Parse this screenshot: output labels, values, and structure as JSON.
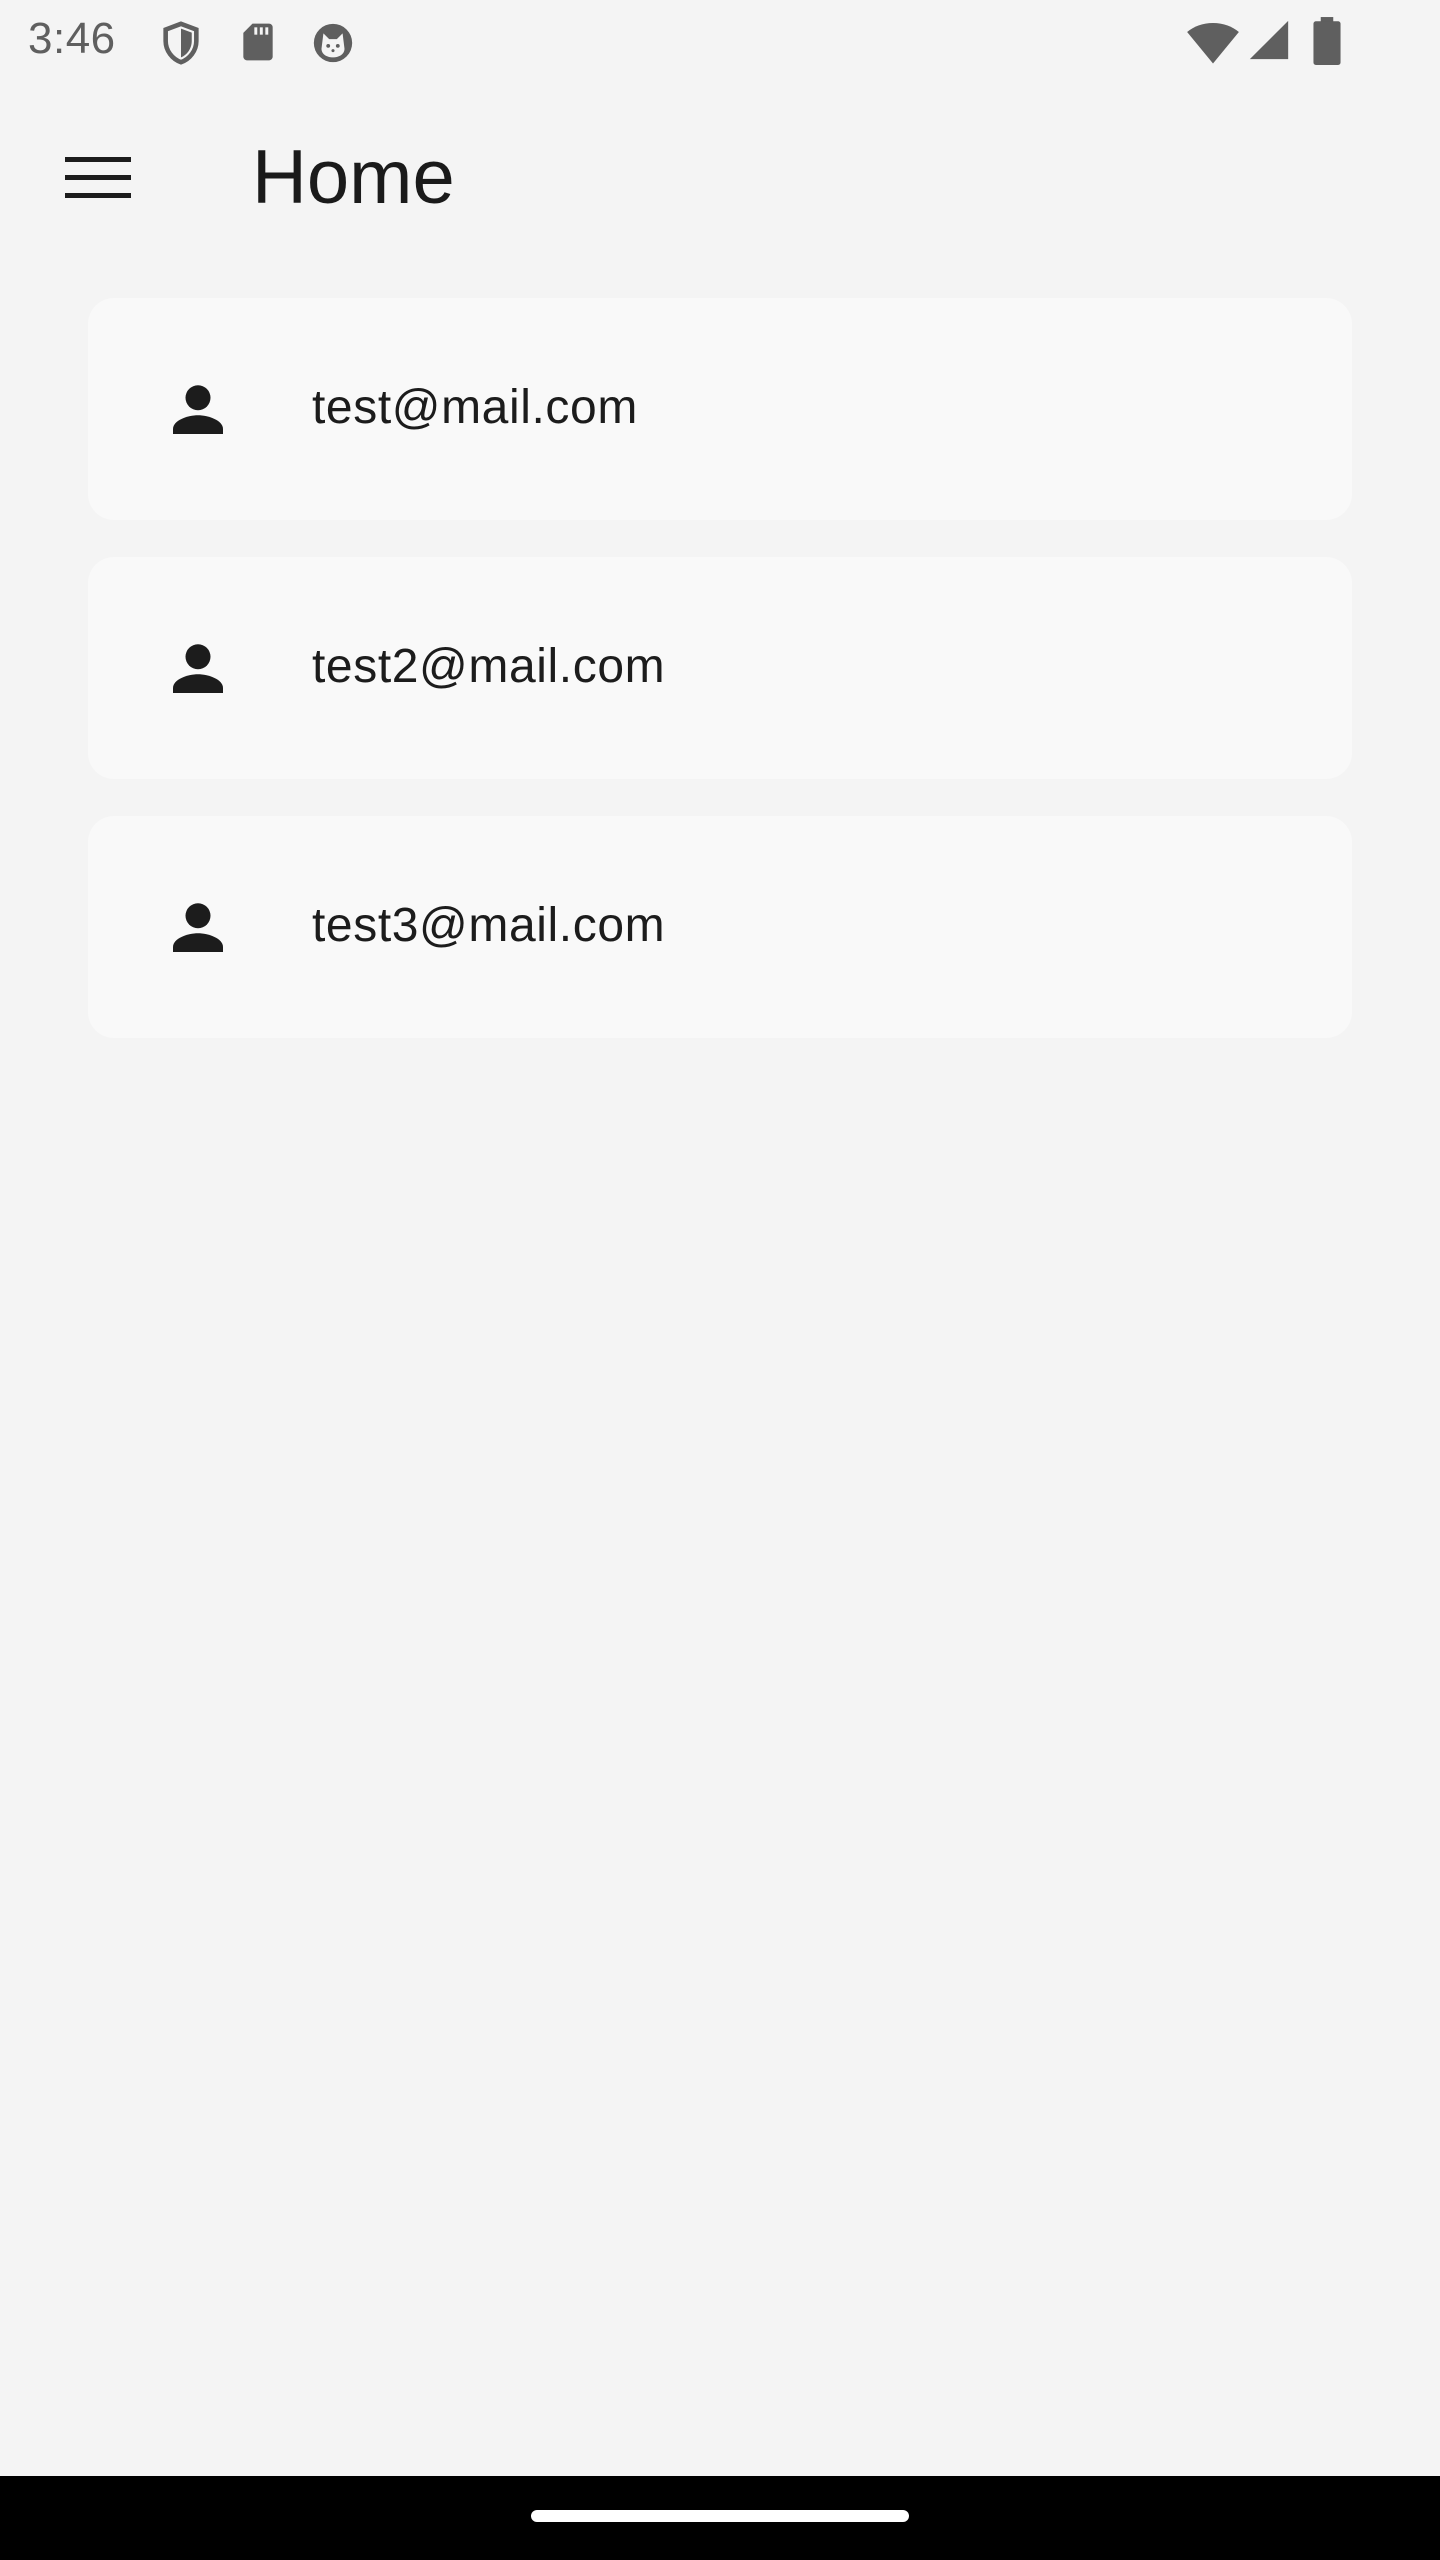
{
  "status_bar": {
    "time": "3:46",
    "left_icons": [
      "shield-icon",
      "sd-card-icon",
      "cat-face-icon"
    ],
    "right_icons": [
      "wifi-icon",
      "cell-signal-icon",
      "battery-icon"
    ]
  },
  "app_bar": {
    "menu_icon": "hamburger-menu-icon",
    "title": "Home"
  },
  "users": [
    {
      "icon": "person-icon",
      "email": "test@mail.com"
    },
    {
      "icon": "person-icon",
      "email": "test2@mail.com"
    },
    {
      "icon": "person-icon",
      "email": "test3@mail.com"
    }
  ],
  "colors": {
    "background": "#f4f4f4",
    "card": "#f9f9f9",
    "text": "#1c1c1c",
    "status_icons": "#5f5f5f",
    "nav_bar": "#000000"
  }
}
